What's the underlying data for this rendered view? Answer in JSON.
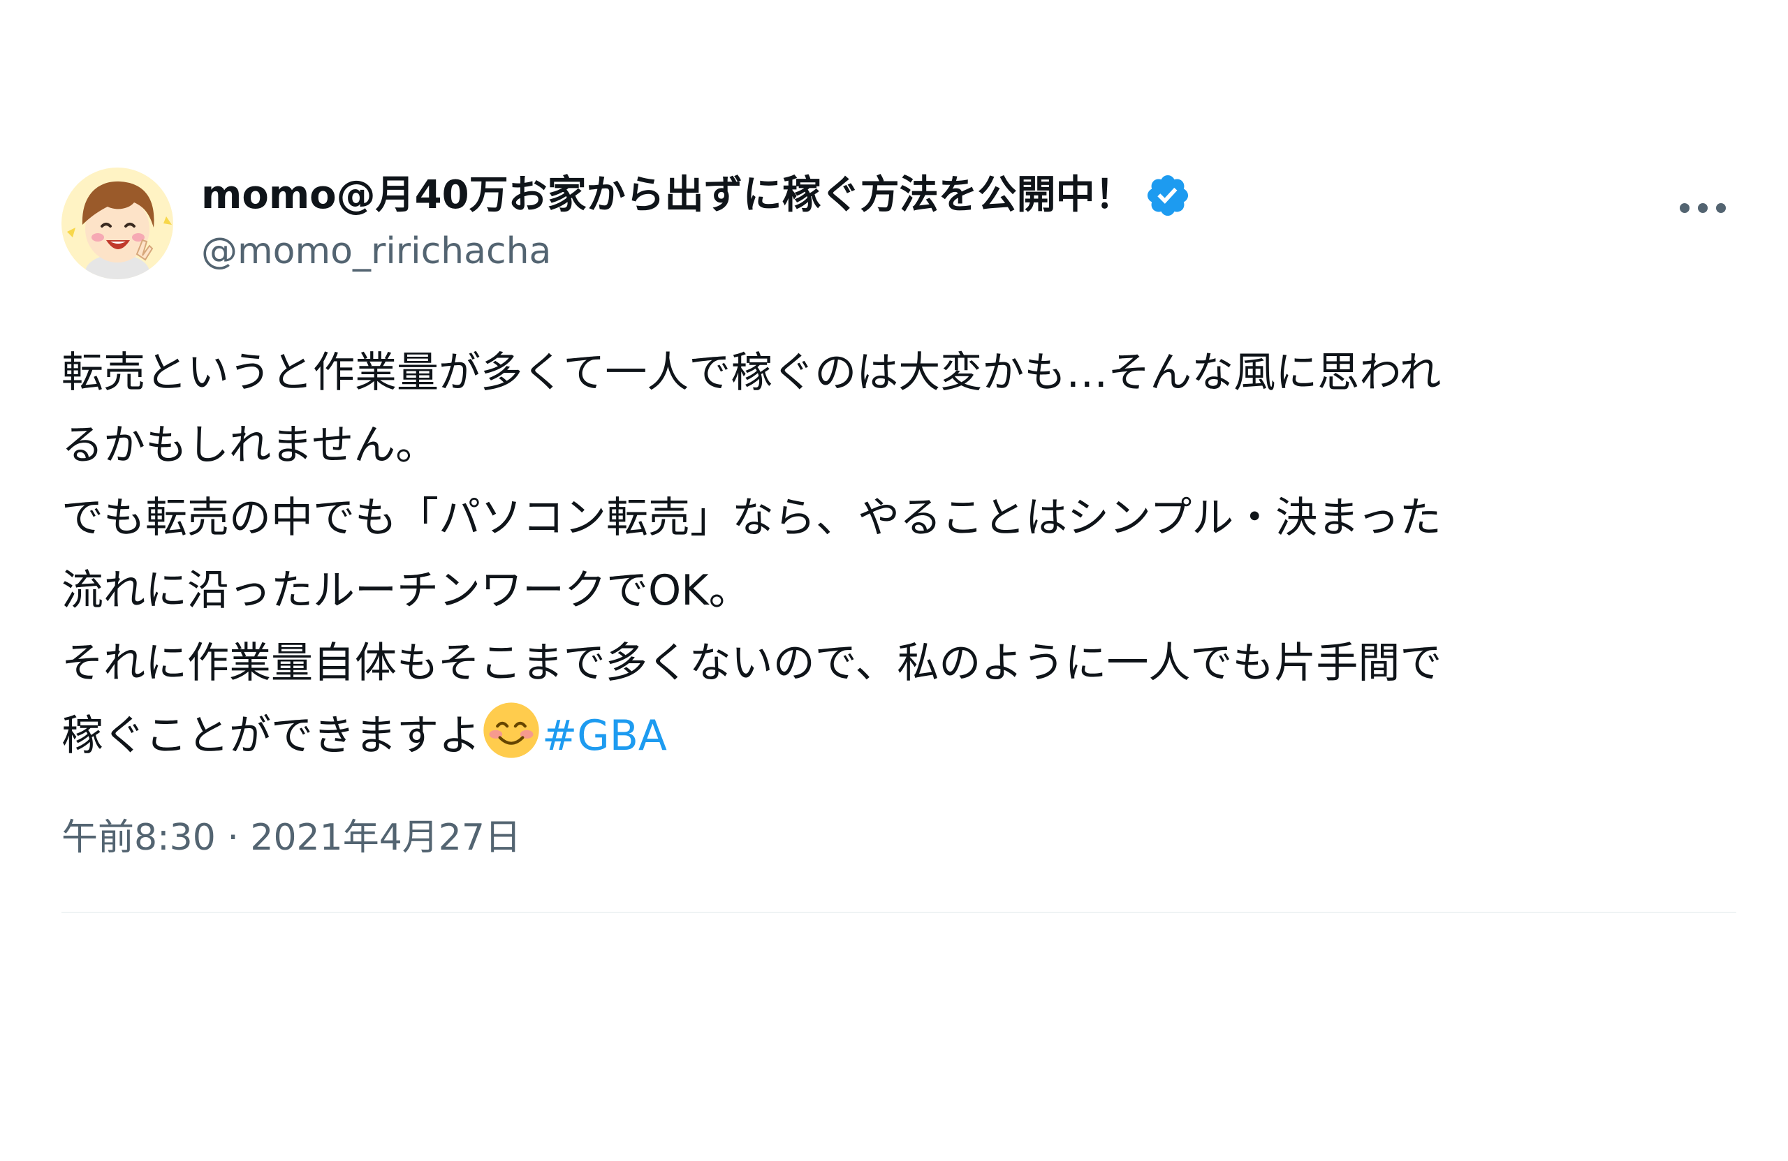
{
  "tweet": {
    "author": {
      "display_name": "momo@月40万お家から出ずに稼ぐ方法を公開中！",
      "handle": "@momo_ririchacha",
      "verified": true,
      "avatar_icon": "cartoon-avatar-icon"
    },
    "body": {
      "line1": "転売というと作業量が多くて一人で稼ぐのは大変かも…そんな風に思われ",
      "line2": "るかもしれません。",
      "line3": "でも転売の中でも「パソコン転売」なら、やることはシンプル・決まった",
      "line4": "流れに沿ったルーチンワークでOK。",
      "line5": "それに作業量自体もそこまで多くないので、私のように一人でも片手間で",
      "line6": "稼ぐことができますよ",
      "emoji": "smiling-face-emoji",
      "hashtag": "#GBA"
    },
    "meta": {
      "time": "午前8:30",
      "separator": "·",
      "date": "2021年4月27日"
    }
  },
  "colors": {
    "text": "#0f1419",
    "secondary": "#536471",
    "link": "#1d9bf0",
    "verified": "#1d9bf0",
    "divider": "#eff3f4"
  }
}
